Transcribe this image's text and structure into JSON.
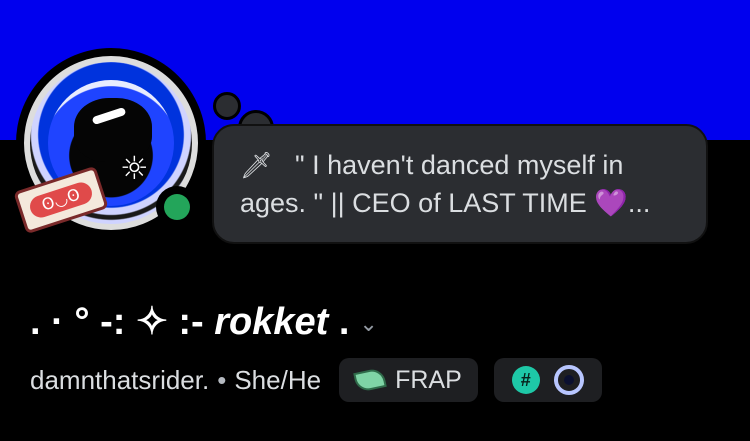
{
  "profile": {
    "bio_line1": "\" I haven't danced myself in",
    "bio_line2": "ages. \" || CEO of LAST TIME ",
    "bio_heart": "💜",
    "bio_ellipsis": "...",
    "dagger_glyph": "🗡",
    "display_name_prefix": ". · ° -: ✧ :- ",
    "display_name": "rokket",
    "display_name_suffix": " .",
    "chevron_glyph": "⌄",
    "username": "damnthatsrider.",
    "separator": "•",
    "pronouns": "She/He",
    "guild_tag": "FRAP",
    "status": "online",
    "status_color": "#23a55a",
    "banner_color": "#0000ee",
    "avatar_sun_glyph": "☼",
    "cassette_face": "ʘ◡ʘ",
    "badge_hash_glyph": "#"
  }
}
